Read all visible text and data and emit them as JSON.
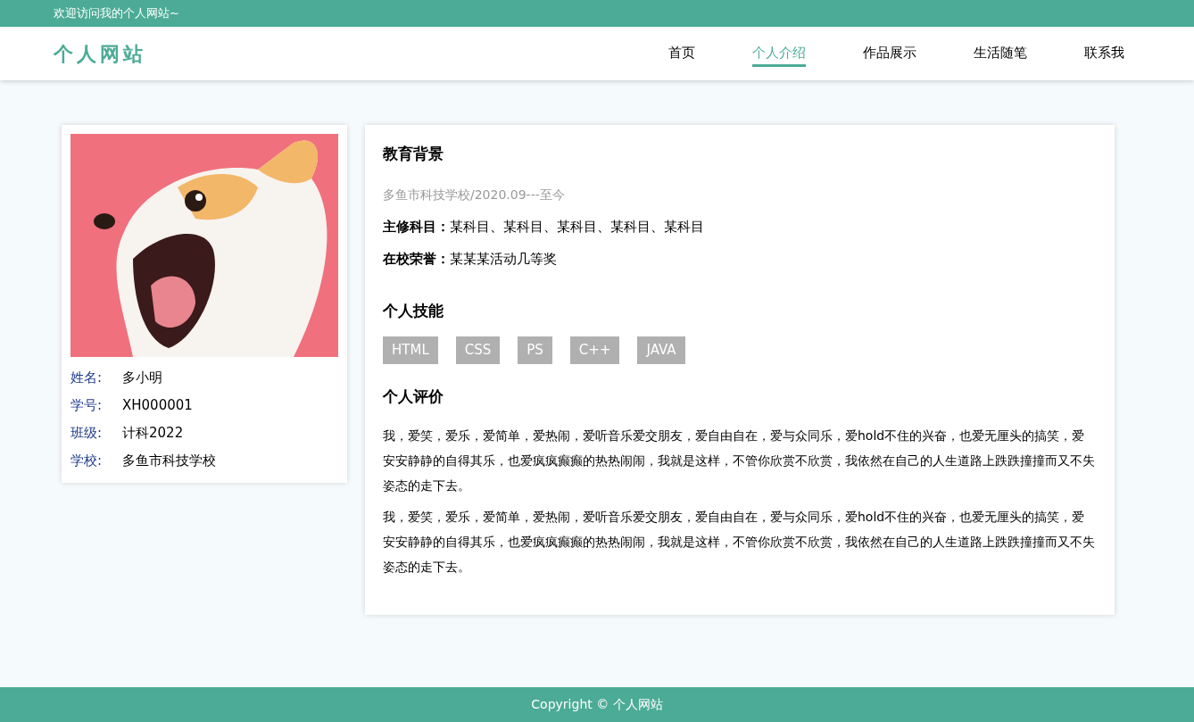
{
  "top_bar": {
    "welcome": "欢迎访问我的个人网站~"
  },
  "header": {
    "logo": "个人网站",
    "nav": [
      {
        "label": "首页",
        "selected": false
      },
      {
        "label": "个人介绍",
        "selected": true
      },
      {
        "label": "作品展示",
        "selected": false
      },
      {
        "label": "生活随笔",
        "selected": false
      },
      {
        "label": "联系我",
        "selected": false
      }
    ]
  },
  "profile": {
    "fields": [
      {
        "label": "姓名:",
        "value": "多小明"
      },
      {
        "label": "学号:",
        "value": "XH000001"
      },
      {
        "label": "班级:",
        "value": "计科2022"
      },
      {
        "label": "学校:",
        "value": "多鱼市科技学校"
      }
    ]
  },
  "education": {
    "title": "教育背景",
    "school": "多鱼市科技学校/2020.09---至今",
    "items": [
      {
        "label": "主修科目：",
        "value": "某科目、某科目、某科目、某科目、某科目"
      },
      {
        "label": "在校荣誉：",
        "value": "某某某活动几等奖"
      }
    ]
  },
  "skills": {
    "title": "个人技能",
    "tags": [
      "HTML",
      "CSS",
      "PS",
      "C++",
      "JAVA"
    ]
  },
  "evaluation": {
    "title": "个人评价",
    "paragraphs": [
      "我，爱笑，爱乐，爱简单，爱热闹，爱听音乐爱交朋友，爱自由自在，爱与众同乐，爱hold不住的兴奋，也爱无厘头的搞笑，爱安安静静的自得其乐，也爱疯疯癫癫的热热闹闹，我就是这样，不管你欣赏不欣赏，我依然在自己的人生道路上跌跌撞撞而又不失姿态的走下去。",
      "我，爱笑，爱乐，爱简单，爱热闹，爱听音乐爱交朋友，爱自由自在，爱与众同乐，爱hold不住的兴奋，也爱无厘头的搞笑，爱安安静静的自得其乐，也爱疯疯癫癫的热热闹闹，我就是这样，不管你欣赏不欣赏，我依然在自己的人生道路上跌跌撞撞而又不失姿态的走下去。"
    ]
  },
  "footer": {
    "copyright": "Copyright © 个人网站"
  }
}
